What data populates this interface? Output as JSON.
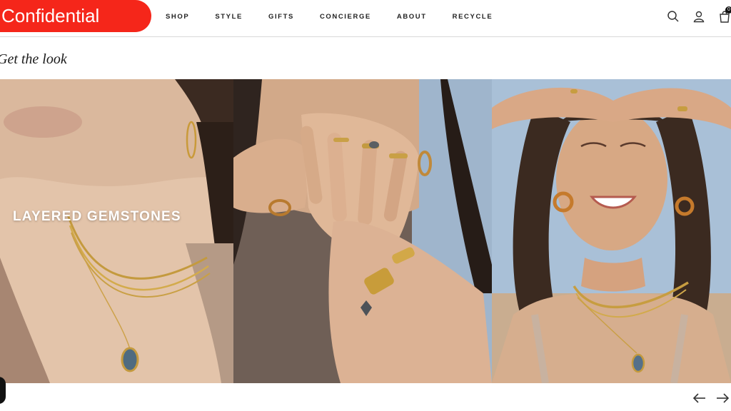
{
  "badge": {
    "label": "Confidential",
    "color": "#f5261a"
  },
  "nav": {
    "items": [
      {
        "label": "SHOP"
      },
      {
        "label": "STYLE"
      },
      {
        "label": "GIFTS"
      },
      {
        "label": "CONCIERGE"
      },
      {
        "label": "ABOUT"
      },
      {
        "label": "RECYCLE"
      }
    ]
  },
  "header_icons": {
    "search": "search-icon",
    "account": "user-icon",
    "cart": "bag-icon",
    "cart_count": "0"
  },
  "section": {
    "title": "Get the look"
  },
  "gallery": {
    "tiles": [
      {
        "caption": "LAYERED GEMSTONES"
      },
      {
        "caption": ""
      },
      {
        "caption": ""
      }
    ]
  },
  "carousel": {
    "prev_icon": "arrow-left-icon",
    "next_icon": "arrow-right-icon"
  }
}
